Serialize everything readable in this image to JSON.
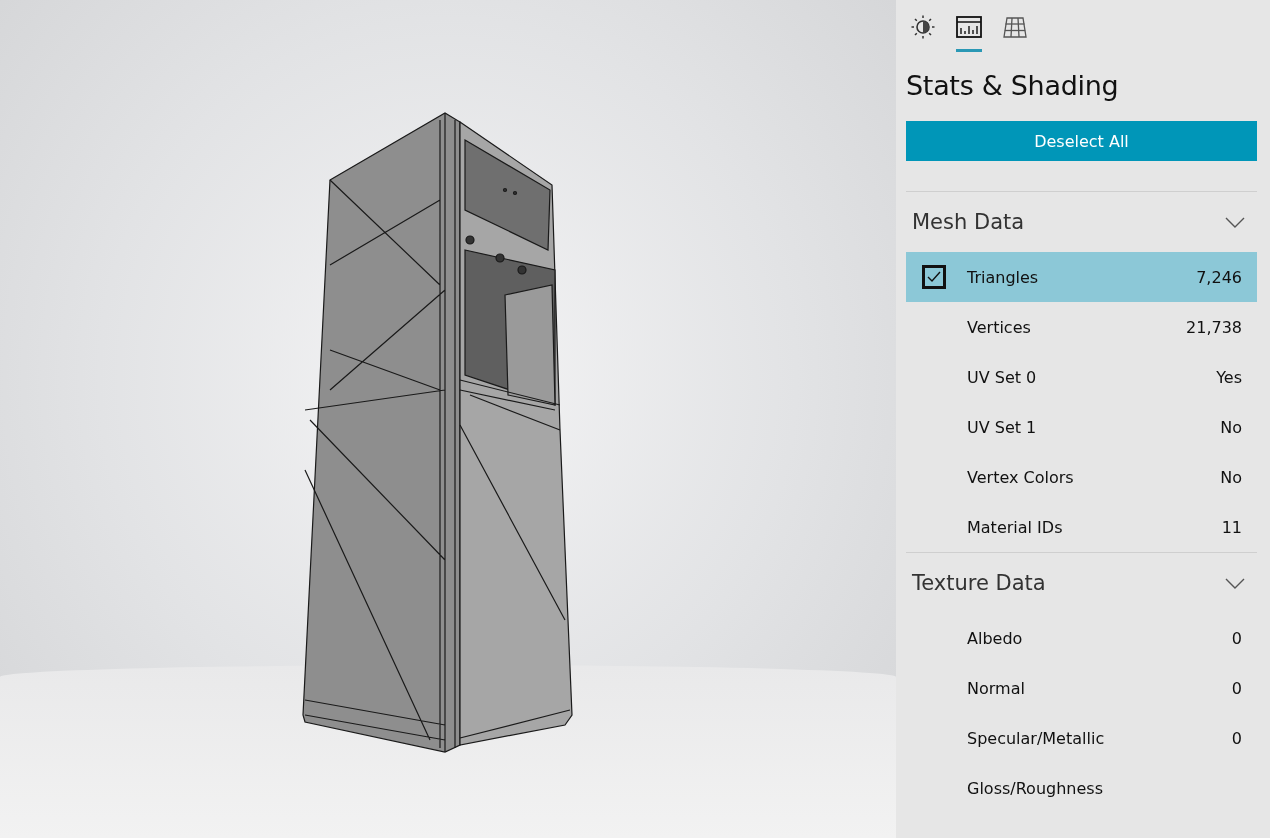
{
  "tabs": [
    {
      "kind": "lighting",
      "selected": false
    },
    {
      "kind": "stats",
      "selected": true
    },
    {
      "kind": "grid",
      "selected": false
    }
  ],
  "panel": {
    "title": "Stats & Shading",
    "button": "Deselect All"
  },
  "sections": [
    {
      "title": "Mesh Data",
      "expanded": true,
      "rows": [
        {
          "label": "Triangles",
          "value": "7,246",
          "selected": true
        },
        {
          "label": "Vertices",
          "value": "21,738",
          "selected": false
        },
        {
          "label": "UV Set 0",
          "value": "Yes",
          "selected": false
        },
        {
          "label": "UV Set 1",
          "value": "No",
          "selected": false
        },
        {
          "label": "Vertex Colors",
          "value": "No",
          "selected": false
        },
        {
          "label": "Material IDs",
          "value": "11",
          "selected": false
        }
      ]
    },
    {
      "title": "Texture Data",
      "expanded": true,
      "rows": [
        {
          "label": "Albedo",
          "value": "0",
          "selected": false
        },
        {
          "label": "Normal",
          "value": "0",
          "selected": false
        },
        {
          "label": "Specular/Metallic",
          "value": "0",
          "selected": false
        },
        {
          "label": "Gloss/Roughness",
          "selected": false
        }
      ]
    }
  ]
}
